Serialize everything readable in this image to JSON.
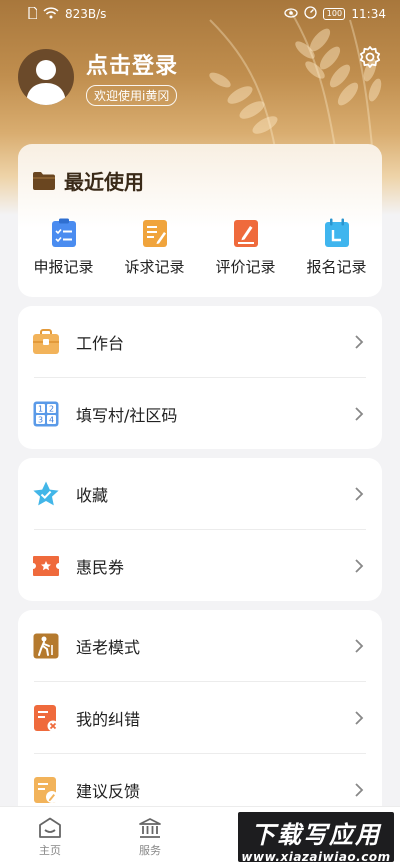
{
  "status_bar": {
    "network_speed": "823B/s",
    "battery": "100",
    "time": "11:34"
  },
  "profile": {
    "title": "点击登录",
    "subtitle": "欢迎使用i黄冈"
  },
  "recent": {
    "title": "最近使用",
    "items": [
      {
        "label": "申报记录",
        "icon": "declaration-record-icon",
        "color": "#4a8cf0"
      },
      {
        "label": "诉求记录",
        "icon": "appeal-record-icon",
        "color": "#f0a43c"
      },
      {
        "label": "评价记录",
        "icon": "evaluation-record-icon",
        "color": "#ef6a3c"
      },
      {
        "label": "报名记录",
        "icon": "registration-record-icon",
        "color": "#3fb5ee"
      }
    ]
  },
  "menu_groups": [
    {
      "items": [
        {
          "label": "工作台",
          "icon": "briefcase-icon"
        },
        {
          "label": "填写村/社区码",
          "icon": "number-grid-icon"
        }
      ]
    },
    {
      "items": [
        {
          "label": "收藏",
          "icon": "star-icon"
        },
        {
          "label": "惠民券",
          "icon": "coupon-icon"
        }
      ]
    },
    {
      "items": [
        {
          "label": "适老模式",
          "icon": "elderly-mode-icon"
        },
        {
          "label": "我的纠错",
          "icon": "error-correction-icon"
        },
        {
          "label": "建议反馈",
          "icon": "feedback-icon"
        }
      ]
    }
  ],
  "bottom_nav": [
    {
      "label": "主页",
      "icon": "home-icon"
    },
    {
      "label": "服务",
      "icon": "service-building-icon"
    }
  ],
  "watermark": {
    "title": "下载写应用",
    "url": "www.xiazaiwiao.com"
  },
  "colors": {
    "accent_brown": "#a8773c",
    "background": "#f3f3f5"
  }
}
